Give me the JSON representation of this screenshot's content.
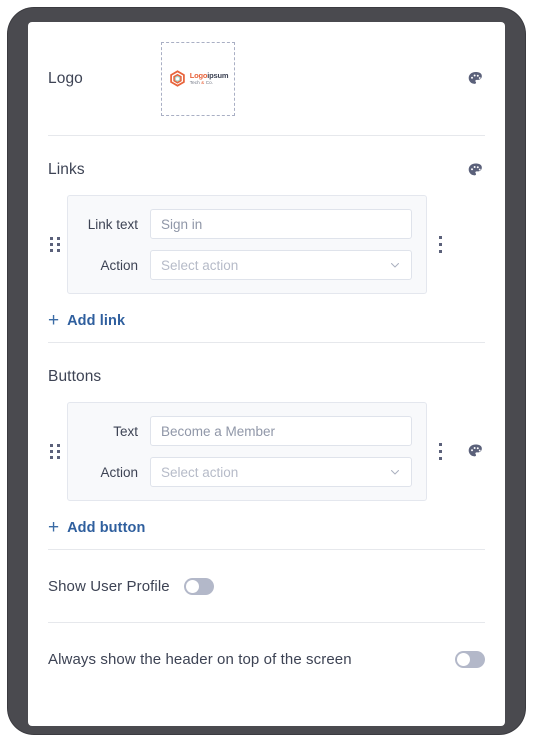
{
  "logo_section": {
    "title": "Logo",
    "logo": {
      "word_primary": "Logo",
      "word_secondary": "ipsum",
      "tagline_pre": "Tech ",
      "tagline_amp": "&",
      "tagline_post": " Co.",
      "hex_color": "#e8643c",
      "hex_inner_color": "#9fd4c9"
    }
  },
  "links_section": {
    "title": "Links",
    "items": [
      {
        "text_label": "Link text",
        "text_value": "Sign in",
        "action_label": "Action",
        "action_value": "Select action"
      }
    ],
    "add_plus": "+",
    "add_label": "Add link"
  },
  "buttons_section": {
    "title": "Buttons",
    "items": [
      {
        "text_label": "Text",
        "text_value": "Become a Member",
        "action_label": "Action",
        "action_value": "Select action"
      }
    ],
    "add_plus": "+",
    "add_label": "Add button"
  },
  "toggles": [
    {
      "label": "Show User Profile",
      "state": "off"
    },
    {
      "label": "Always show the header on top of the screen",
      "state": "off"
    }
  ],
  "colors": {
    "accent_link": "#2f5f9e",
    "text_primary": "#3d4354",
    "text_placeholder": "#b6bbc8",
    "icon": "#5b617a",
    "divider": "#e6e8ec",
    "card_bg": "#f8f9fb",
    "switch_off": "#b3b8c9"
  },
  "icons": {
    "palette": "palette-icon",
    "drag": "drag-handle-icon",
    "kebab": "kebab-menu-icon",
    "chevron": "chevron-down-icon"
  }
}
